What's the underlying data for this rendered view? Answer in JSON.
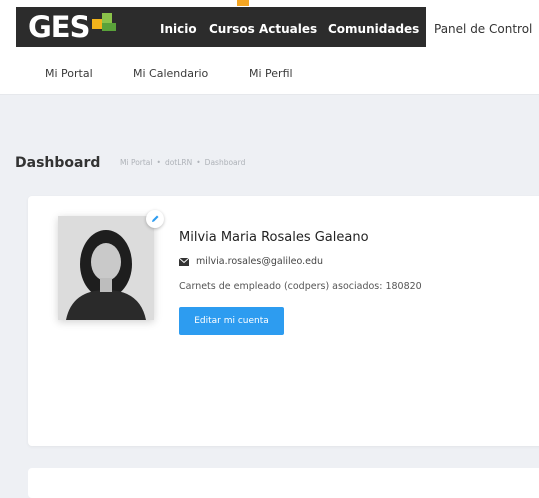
{
  "brand": {
    "logo_text": "GES"
  },
  "nav": {
    "items": [
      "Inicio",
      "Cursos Actuales",
      "Comunidades"
    ],
    "active": "Panel de Control"
  },
  "subnav": {
    "items": [
      "Mi Portal",
      "Mi Calendario",
      "Mi Perfil"
    ]
  },
  "page": {
    "title": "Dashboard",
    "breadcrumb": [
      "Mi Portal",
      "dotLRN",
      "Dashboard"
    ]
  },
  "profile": {
    "name": "Milvia Maria Rosales Galeano",
    "email": "milvia.rosales@galileo.edu",
    "carnets": "Carnets de empleado (codpers) asociados: 180820",
    "edit_button": "Editar mi cuenta"
  },
  "colors": {
    "nav_bg": "#2c2c2c",
    "accent": "#2d9cf0",
    "logo_orange": "#f3b41b",
    "logo_green": "#8bc34a"
  }
}
